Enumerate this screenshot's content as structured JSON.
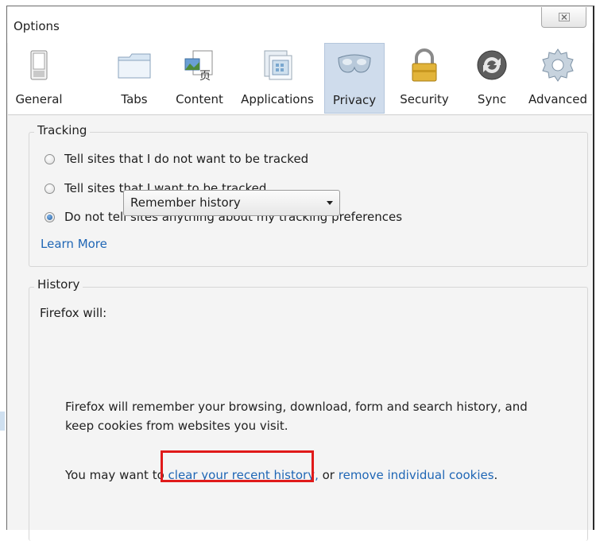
{
  "window": {
    "title": "Options",
    "close_glyph": "☒"
  },
  "toolbar": {
    "panes": [
      {
        "label": "General",
        "icon": "switch-icon",
        "selected": false
      },
      {
        "label": "Tabs",
        "icon": "folder-tabs-icon",
        "selected": false
      },
      {
        "label": "Content",
        "icon": "content-page-icon",
        "selected": false
      },
      {
        "label": "Applications",
        "icon": "applications-icon",
        "selected": false
      },
      {
        "label": "Privacy",
        "icon": "mask-icon",
        "selected": true
      },
      {
        "label": "Security",
        "icon": "padlock-icon",
        "selected": false
      },
      {
        "label": "Sync",
        "icon": "sync-icon",
        "selected": false
      },
      {
        "label": "Advanced",
        "icon": "gear-icon",
        "selected": false
      }
    ]
  },
  "tracking": {
    "caption": "Tracking",
    "options": [
      {
        "label": "Tell sites that I do not want to be tracked",
        "checked": false
      },
      {
        "label": "Tell sites that I want to be tracked",
        "checked": false
      },
      {
        "label": "Do not tell sites anything about my tracking preferences",
        "checked": true
      }
    ],
    "learn_more": "Learn More"
  },
  "history": {
    "caption": "History",
    "firefox_will_label": "Firefox will:",
    "mode_value": "Remember history",
    "description_line1": "Firefox will remember your browsing, download, form and search history, and",
    "description_line2": "keep cookies from websites you visit.",
    "you_may_want": "You may want to",
    "clear_link": "clear your recent history,",
    "or_text": " or ",
    "cookies_link": "remove individual cookies",
    "period": "."
  },
  "colors": {
    "link": "#1f66b5",
    "selected_pane": "#cfdcec",
    "highlight": "#e01a1a"
  }
}
